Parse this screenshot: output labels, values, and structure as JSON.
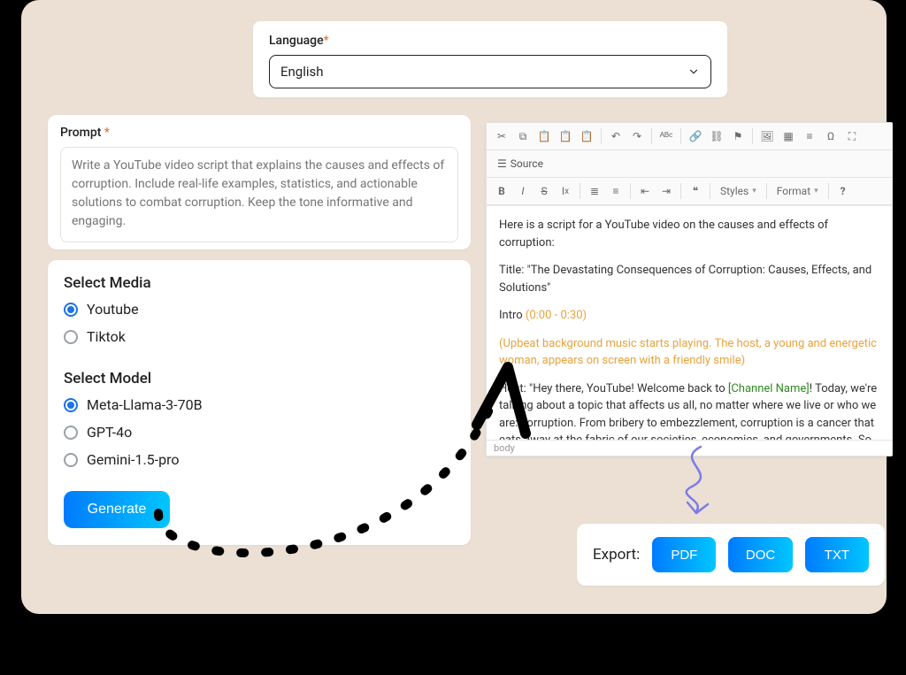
{
  "language": {
    "label": "Language",
    "required_mark": "*",
    "selected": "English"
  },
  "prompt": {
    "label": "Prompt",
    "required_mark": "*",
    "placeholder": "Write a YouTube video script that explains the causes and effects of corruption. Include real-life examples, statistics, and actionable solutions to combat corruption. Keep the tone informative and engaging."
  },
  "media": {
    "title": "Select Media",
    "options": [
      {
        "label": "Youtube",
        "checked": true
      },
      {
        "label": "Tiktok",
        "checked": false
      }
    ]
  },
  "model": {
    "title": "Select Model",
    "options": [
      {
        "label": "Meta-Llama-3-70B",
        "checked": true
      },
      {
        "label": "GPT-4o",
        "checked": false
      },
      {
        "label": "Gemini-1.5-pro",
        "checked": false
      }
    ]
  },
  "generate_label": "Generate",
  "editor": {
    "source_label": "Source",
    "styles_label": "Styles",
    "format_label": "Format",
    "status": "body",
    "content": {
      "line1": "Here is a script for a YouTube video on the causes and effects of corruption:",
      "line2": "Title: \"The Devastating Consequences of Corruption: Causes, Effects, and Solutions\"",
      "line3a": "Intro ",
      "intro_time": "(0:00 - 0:30)",
      "line4": "(Upbeat background music starts playing. The host, a young and energetic woman, appears on screen with a friendly smile)",
      "line5a": "Host: \"Hey there, YouTube! Welcome back to ",
      "channel_name": "[Channel Name]",
      "line5b": "! Today, we're talking about a topic that affects us all, no matter where we live or who we are: corruption. From bribery to embezzlement, corruption is a cancer that eats away at the fabric of our societies, economies, and governments. So, let's dive in and explore the causes, effects, and most importantly, solutions to this pervasive problem.\""
    }
  },
  "export": {
    "label": "Export:",
    "buttons": [
      "PDF",
      "DOC",
      "TXT"
    ]
  }
}
